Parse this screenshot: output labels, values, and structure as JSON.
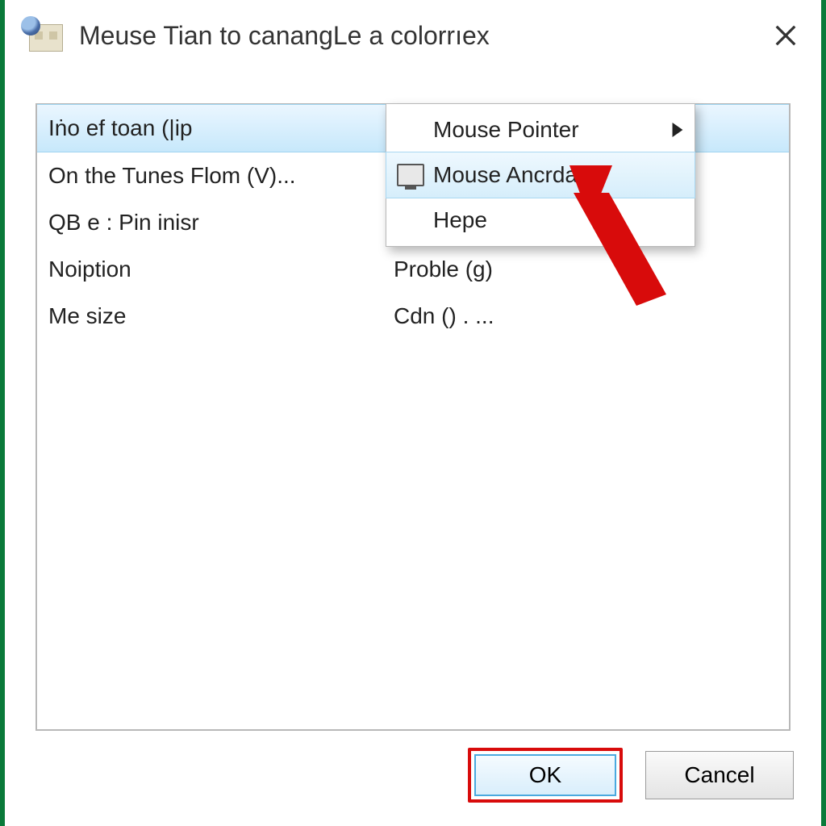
{
  "window": {
    "title": "Meuse Tian to canangLe a colorrıex"
  },
  "list": {
    "selected": "Iṅo ef toan (|ip",
    "items": [
      "On the Tunes Flom (V)...",
      "QB e : Pin inisr",
      "Noiption",
      "Me size"
    ],
    "right_items": [
      "Proble (g)",
      "Cdn () . ..."
    ]
  },
  "context_menu": {
    "items": [
      {
        "label": "Mouse Pointer",
        "has_submenu": true
      },
      {
        "label": "Mouse Ancrdary",
        "icon": "monitor-icon",
        "hovered": true
      },
      {
        "label": "Hepe"
      }
    ]
  },
  "buttons": {
    "ok": "OK",
    "cancel": "Cancel"
  }
}
